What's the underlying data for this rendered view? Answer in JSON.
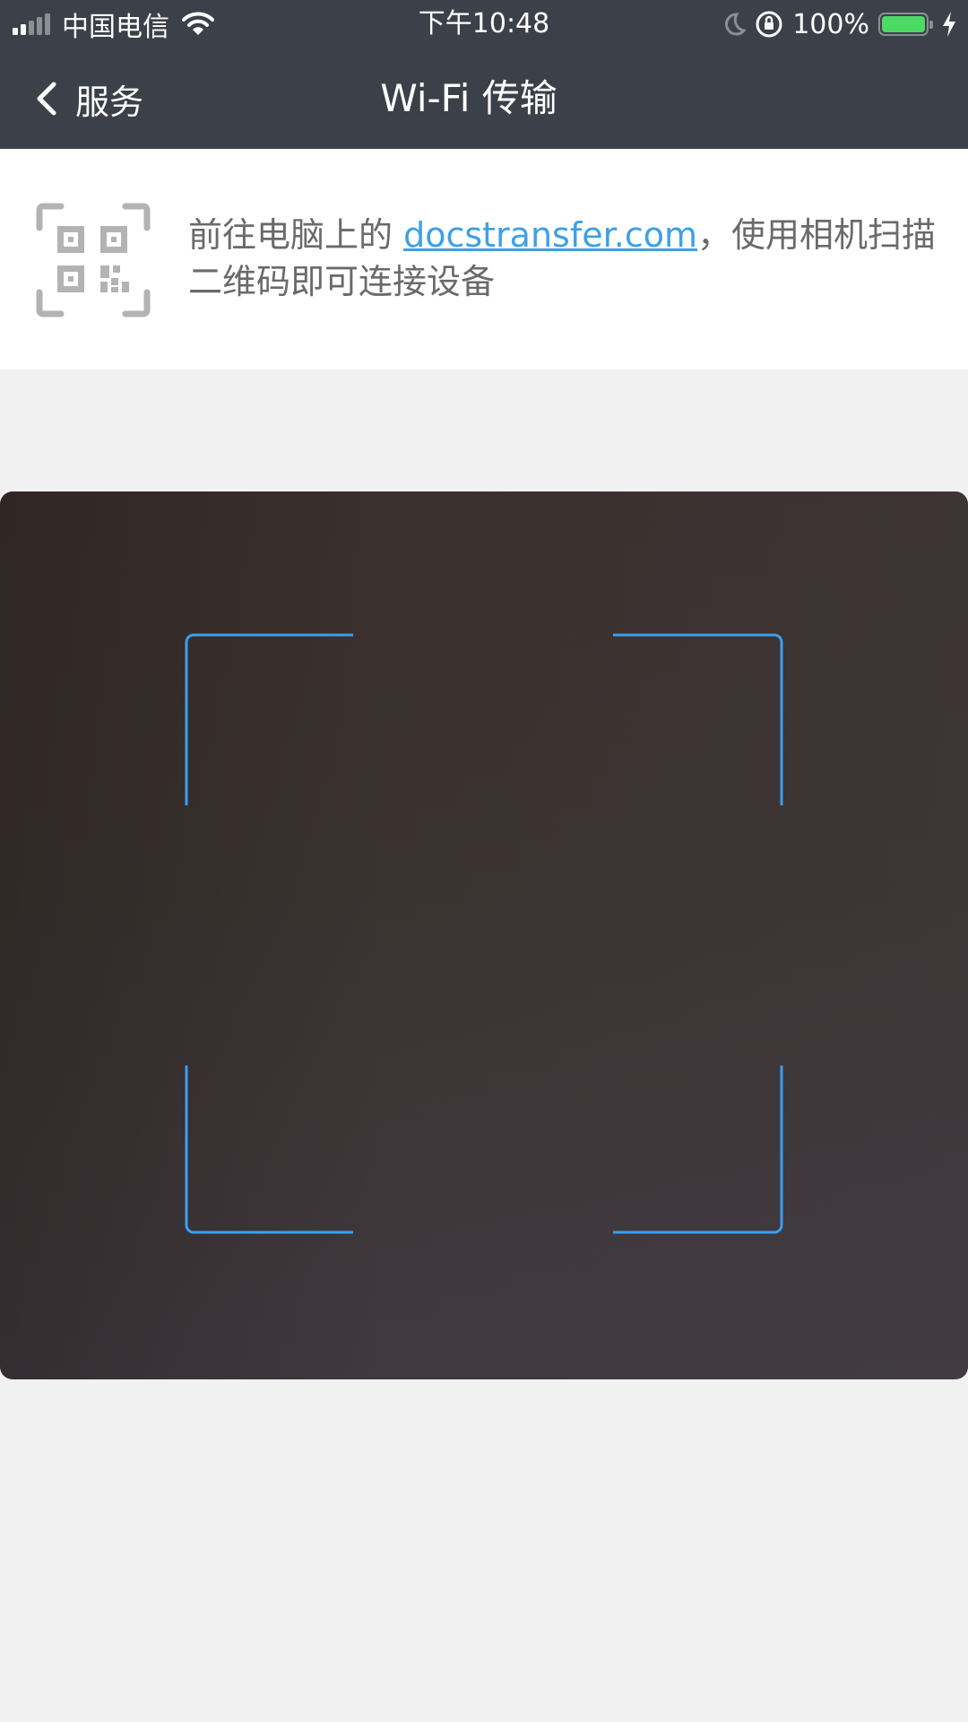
{
  "status_bar": {
    "carrier": "中国电信",
    "time": "下午10:48",
    "battery_percent": "100%",
    "battery_level": 1.0,
    "battery_color": "#4cd964",
    "icons": [
      "signal-icon",
      "wifi-icon",
      "moon-icon",
      "orientation-lock-icon",
      "battery-icon",
      "charging-icon"
    ]
  },
  "nav": {
    "back_label": "服务",
    "title": "Wi-Fi 传输"
  },
  "info": {
    "prefix": "前往电脑上的 ",
    "link": "docstransfer.com",
    "suffix": "，使用相机扫描二维码即可连接设备",
    "link_color": "#3ea0e6"
  },
  "scanner": {
    "frame_color": "#3a9ff0"
  }
}
